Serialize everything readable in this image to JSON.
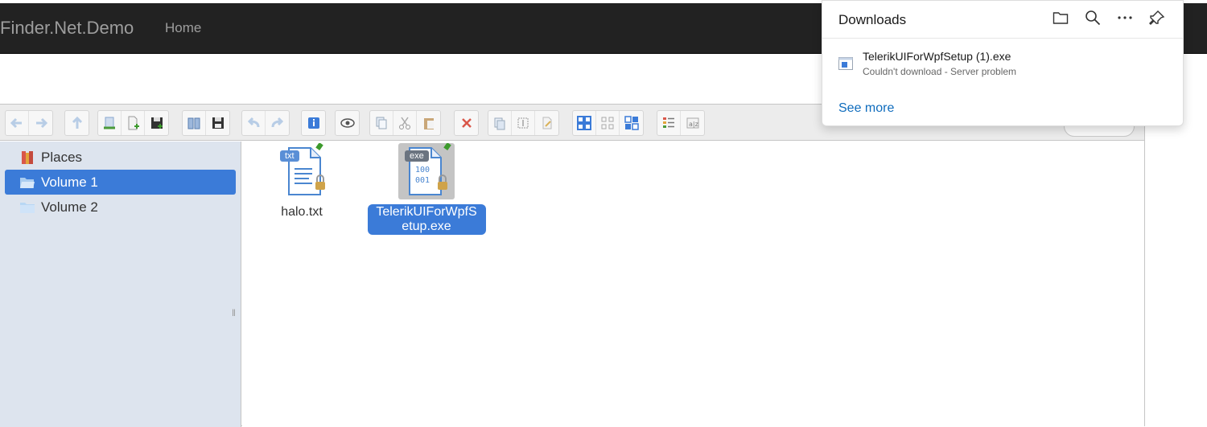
{
  "navbar": {
    "brand": "Finder.Net.Demo",
    "home": "Home"
  },
  "sidebar": {
    "items": [
      {
        "label": "Places",
        "icon": "places-icon"
      },
      {
        "label": "Volume 1",
        "icon": "folder-open-icon",
        "selected": true
      },
      {
        "label": "Volume 2",
        "icon": "folder-icon"
      }
    ]
  },
  "files": [
    {
      "name": "halo.txt",
      "ext": "txt",
      "selected": false
    },
    {
      "name": "TelerikUIForWpfSetup.exe",
      "name_line1": "TelerikUIForWpfS",
      "name_line2": "etup.exe",
      "ext": "exe",
      "selected": true
    }
  ],
  "downloads": {
    "title": "Downloads",
    "item_name": "TelerikUIForWpfSetup (1).exe",
    "item_status": "Couldn't download - Server problem",
    "see_more": "See more"
  },
  "colors": {
    "navbar_bg": "#222222",
    "selection": "#3b7bd8",
    "sidebar_bg": "#dde4ee",
    "link": "#0f6cbd"
  }
}
